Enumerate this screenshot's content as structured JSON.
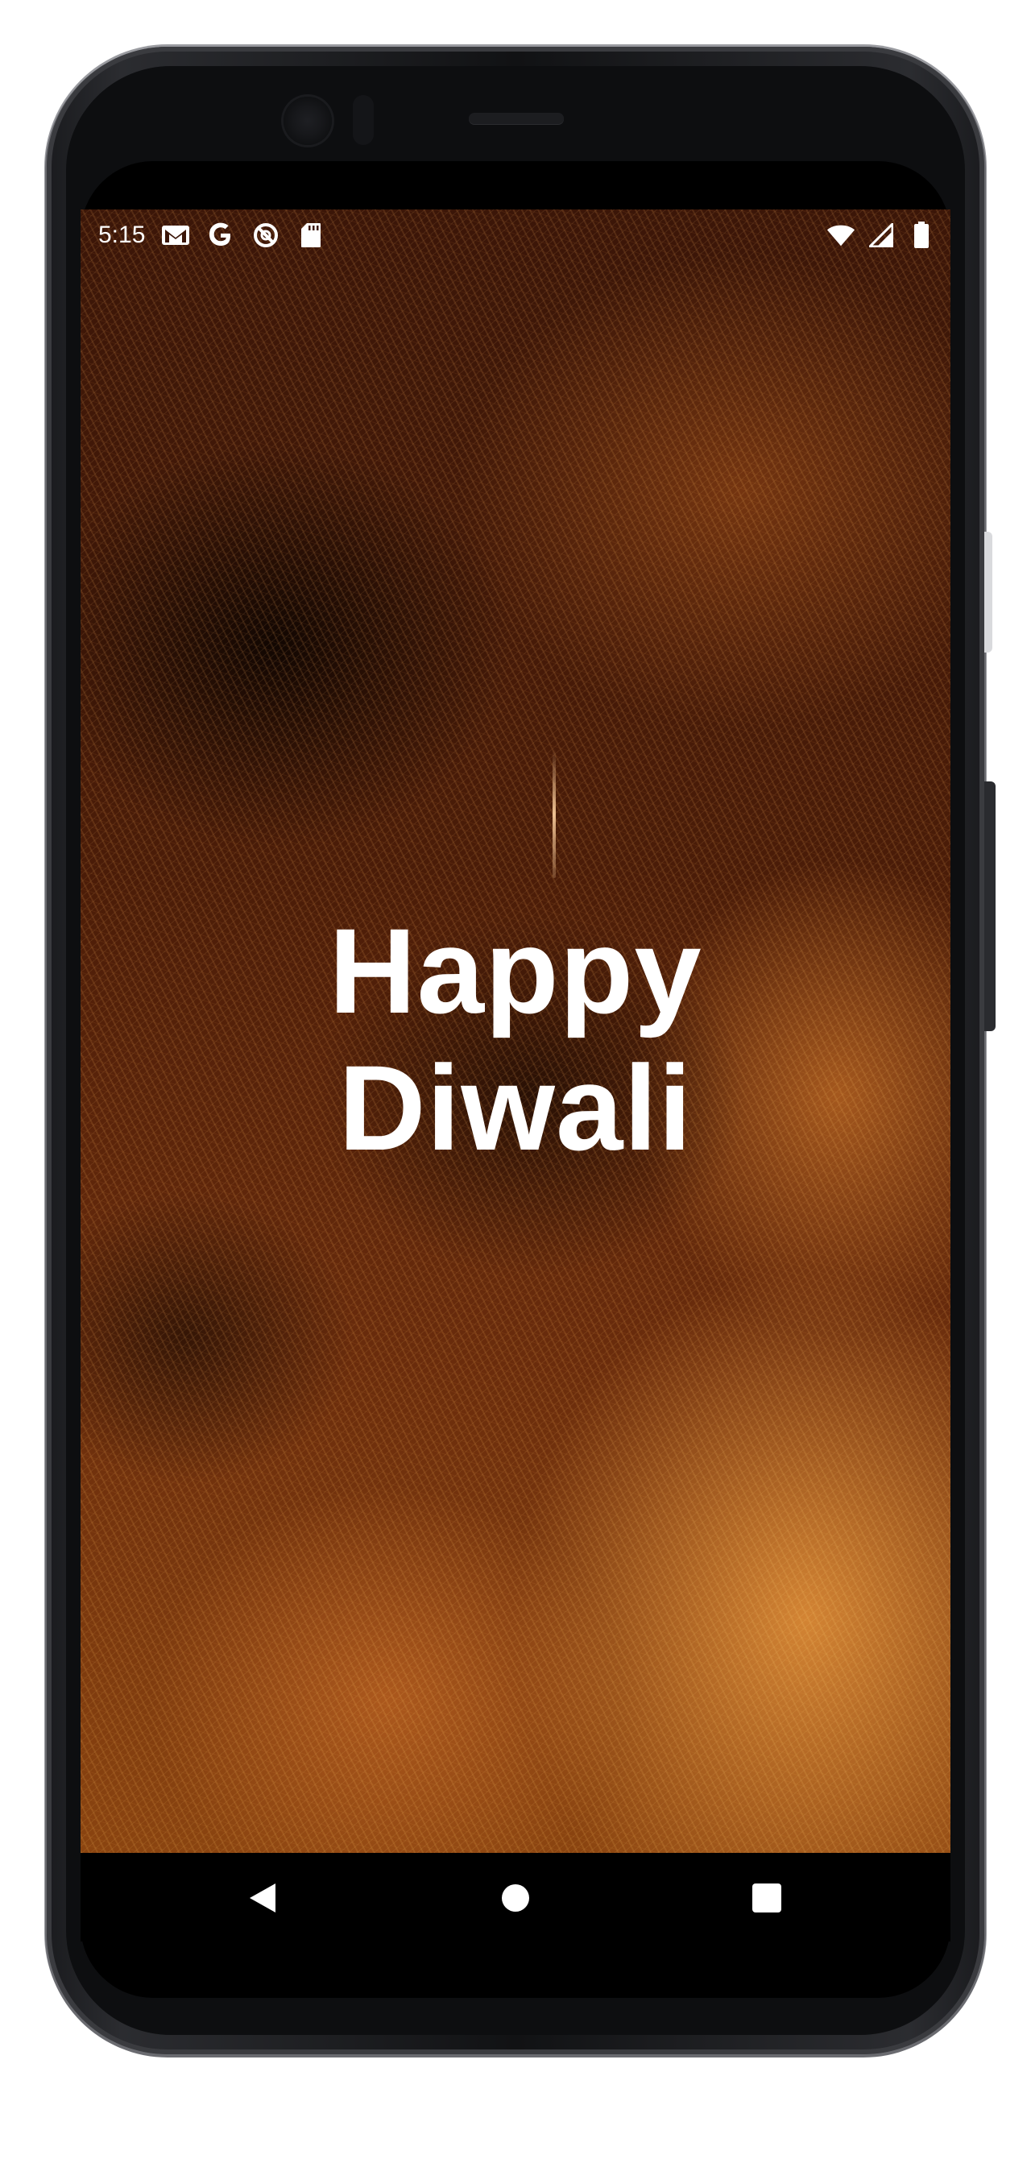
{
  "status_bar": {
    "time": "5:15",
    "left_icons": [
      "gmail-icon",
      "google-icon",
      "no-sync-icon",
      "sd-card-icon"
    ],
    "right_icons": [
      "wifi-icon",
      "cell-signal-icon",
      "battery-icon"
    ]
  },
  "greeting": {
    "line1": "Happy",
    "line2": "Diwali"
  },
  "nav": {
    "back": "back-icon",
    "home": "home-icon",
    "recents": "recents-icon"
  },
  "colors": {
    "text": "#ffffff",
    "background_dark": "#3b1608",
    "background_glow": "#e2913a"
  }
}
